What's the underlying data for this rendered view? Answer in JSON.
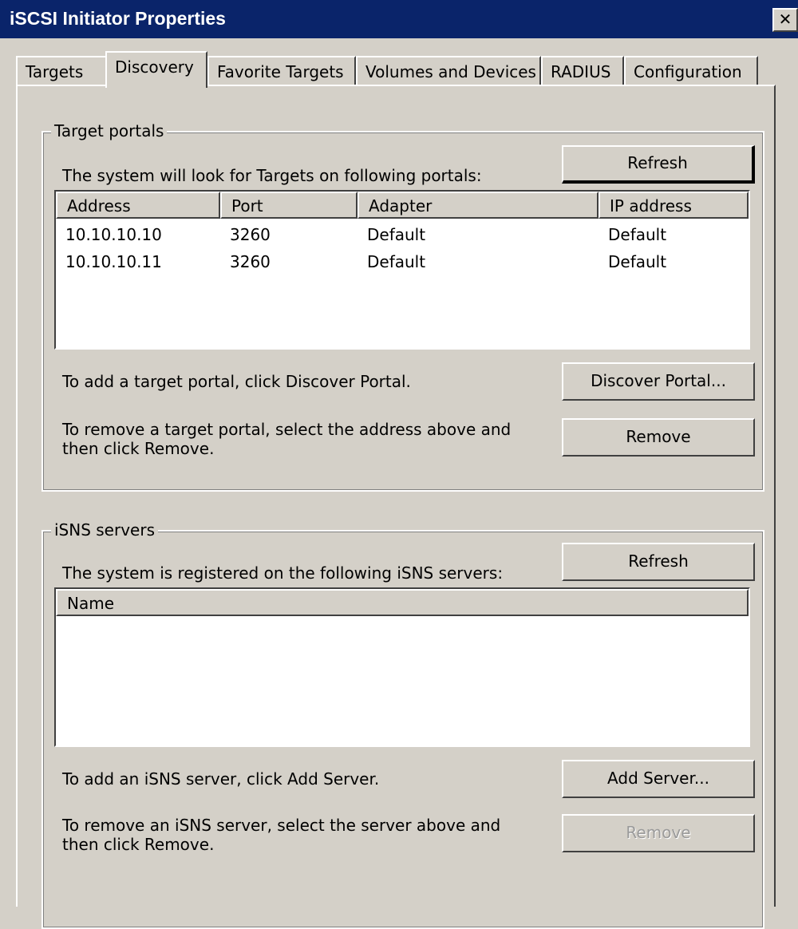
{
  "window": {
    "title": "iSCSI Initiator Properties",
    "close_glyph": "✕"
  },
  "tabs": [
    "Targets",
    "Discovery",
    "Favorite Targets",
    "Volumes and Devices",
    "RADIUS",
    "Configuration"
  ],
  "active_tab": "Discovery",
  "target_portals": {
    "group_label": "Target portals",
    "description": "The system will look for Targets on following portals:",
    "refresh_label": "Refresh",
    "columns": [
      "Address",
      "Port",
      "Adapter",
      "IP address"
    ],
    "rows": [
      [
        "10.10.10.10",
        "3260",
        "Default",
        "Default"
      ],
      [
        "10.10.10.11",
        "3260",
        "Default",
        "Default"
      ]
    ],
    "add_text": "To add a target portal, click Discover Portal.",
    "discover_label": "Discover Portal...",
    "remove_text": "To remove a target portal, select the address above and then click Remove.",
    "remove_label": "Remove"
  },
  "isns_servers": {
    "group_label": "iSNS servers",
    "description": "The system is registered on the following iSNS servers:",
    "refresh_label": "Refresh",
    "columns": [
      "Name"
    ],
    "add_text": "To add an iSNS server, click Add Server.",
    "add_label": "Add Server...",
    "remove_text": "To remove an iSNS server, select the server above and then click Remove.",
    "remove_label": "Remove",
    "remove_disabled": true
  }
}
